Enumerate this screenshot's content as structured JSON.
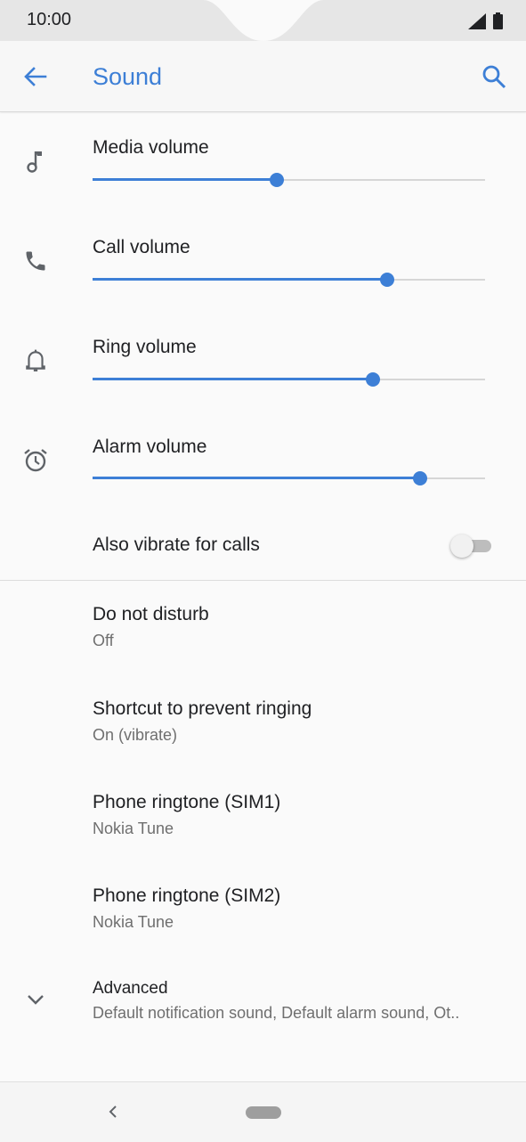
{
  "status": {
    "time": "10:00"
  },
  "appbar": {
    "title": "Sound"
  },
  "volumes": [
    {
      "label": "Media volume",
      "level": 0.47,
      "icon": "music-note-icon"
    },
    {
      "label": "Call volume",
      "level": 0.75,
      "icon": "phone-icon"
    },
    {
      "label": "Ring volume",
      "level": 0.715,
      "icon": "bell-icon"
    },
    {
      "label": "Alarm volume",
      "level": 0.835,
      "icon": "alarm-clock-icon"
    }
  ],
  "vibrate": {
    "label": "Also vibrate for calls",
    "on": false
  },
  "prefs": [
    {
      "title": "Do not disturb",
      "subtitle": "Off"
    },
    {
      "title": "Shortcut to prevent ringing",
      "subtitle": "On (vibrate)"
    },
    {
      "title": "Phone ringtone (SIM1)",
      "subtitle": "Nokia Tune"
    },
    {
      "title": "Phone ringtone (SIM2)",
      "subtitle": "Nokia Tune"
    }
  ],
  "advanced": {
    "title": "Advanced",
    "subtitle": "Default notification sound, Default alarm sound, Ot.."
  },
  "colors": {
    "accent": "#3d7fd6",
    "track": "#d6d6d6",
    "statusbar": "#e6e6e6"
  }
}
